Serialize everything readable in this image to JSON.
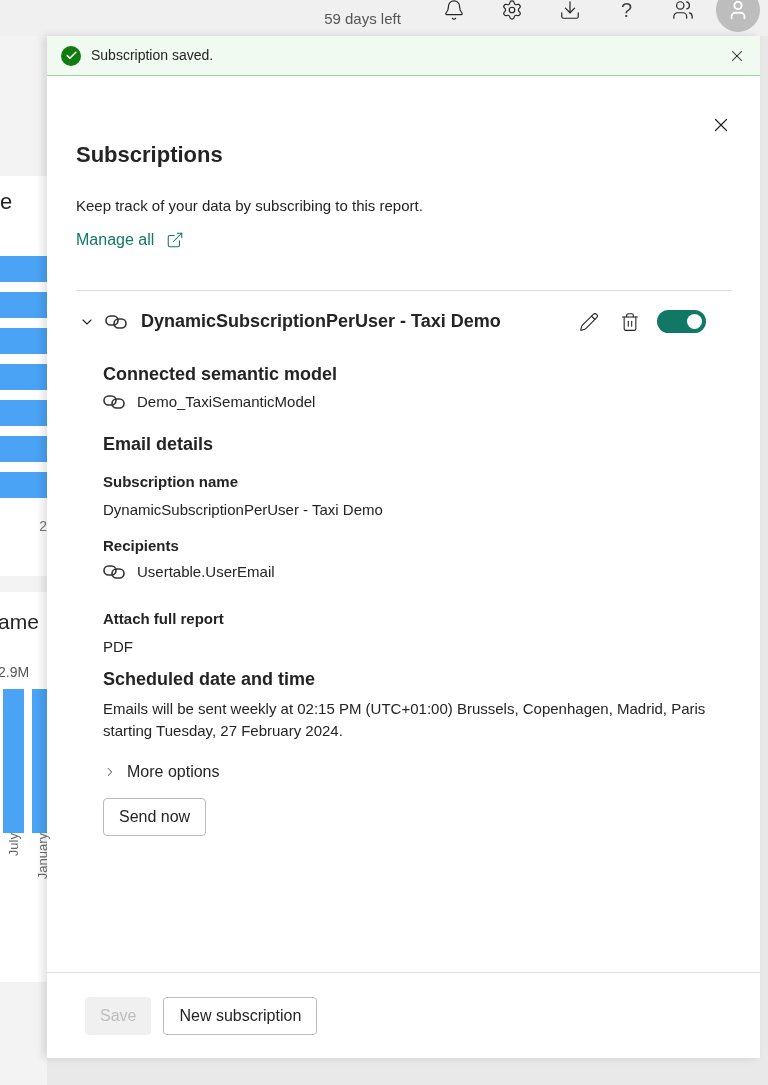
{
  "top_bar": {
    "trial": "59 days left",
    "help": "?"
  },
  "report": {
    "card_1": {
      "title": "e",
      "axis_label": "2"
    },
    "card_2": {
      "title": "ame",
      "value_label": "2.9M",
      "columns": [
        "July",
        "January"
      ]
    }
  },
  "toast": {
    "message": "Subscription saved."
  },
  "panel": {
    "title": "Subscriptions",
    "description": "Keep track of your data by subscribing to this report.",
    "manage_link": "Manage all",
    "subscription": {
      "name": "DynamicSubscriptionPerUser - Taxi Demo",
      "expanded": true,
      "on": true,
      "sections": [
        {
          "kind": "heading",
          "text": "Connected semantic model"
        },
        {
          "kind": "linked",
          "text": "Demo_TaxiSemanticModel"
        },
        {
          "kind": "heading",
          "text": "Email details"
        },
        {
          "kind": "label",
          "text": "Subscription name"
        },
        {
          "kind": "value",
          "text": "DynamicSubscriptionPerUser - Taxi Demo"
        },
        {
          "kind": "label",
          "text": "Recipients"
        },
        {
          "kind": "linked",
          "text": "Usertable.UserEmail"
        },
        {
          "kind": "label",
          "text": "Attach full report"
        },
        {
          "kind": "value",
          "text": "PDF"
        },
        {
          "kind": "heading",
          "text": "Scheduled date and time"
        },
        {
          "kind": "value",
          "text": "Emails will be sent weekly at 02:15 PM (UTC+01:00) Brussels, Copenhagen, Madrid, Paris starting Tuesday, 27 February 2024."
        }
      ],
      "more_options": {
        "label": "More options",
        "expanded": false
      },
      "send_button": "Send now"
    },
    "footer": {
      "save": {
        "label": "Save",
        "disabled": true
      },
      "new": {
        "label": "New subscription"
      }
    }
  }
}
